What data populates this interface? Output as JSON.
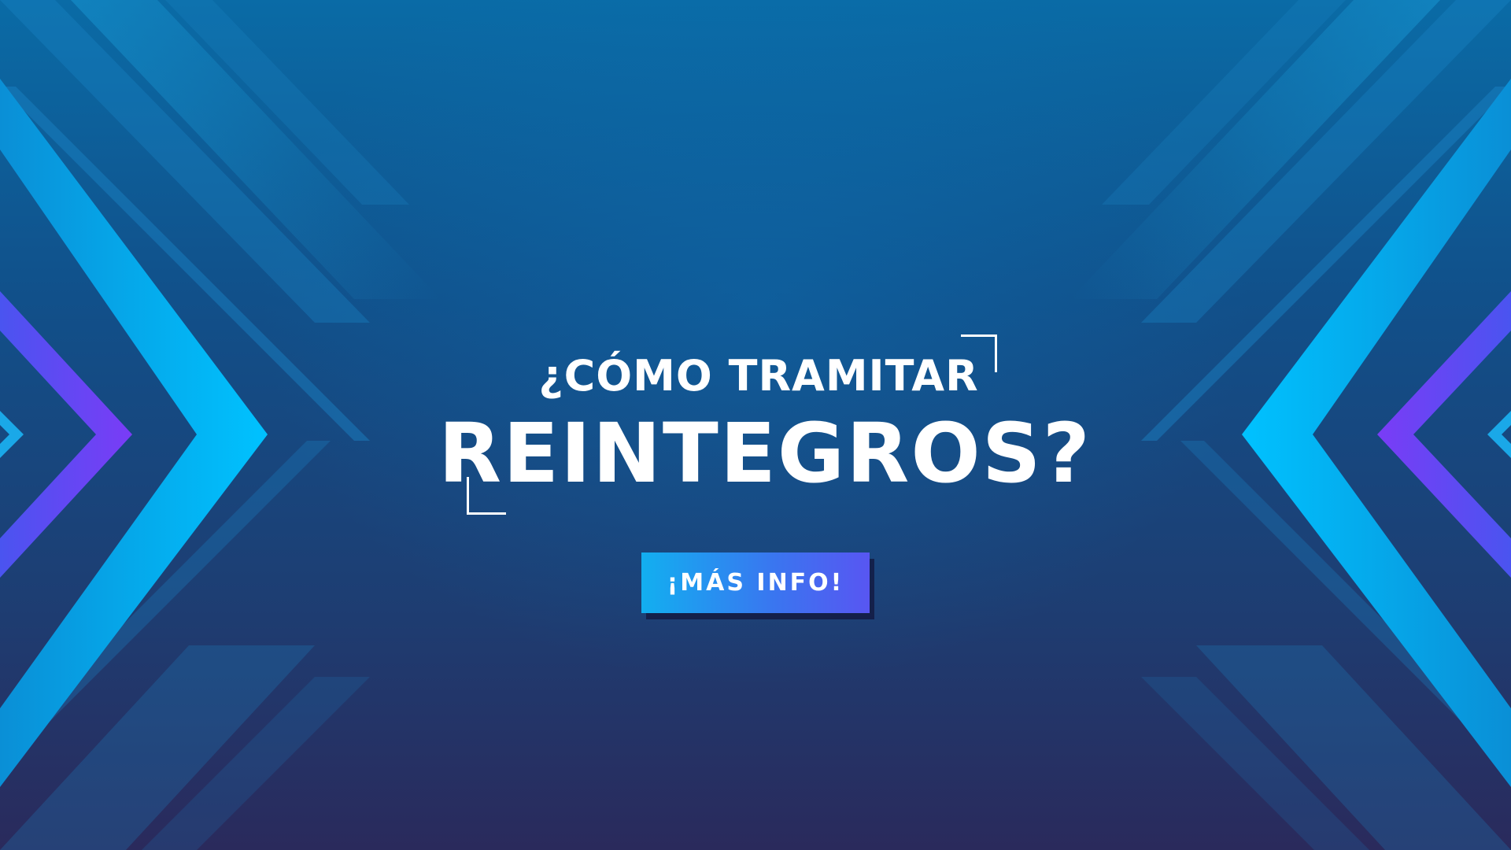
{
  "banner": {
    "heading_line1": "¿CÓMO TRAMITAR",
    "heading_line2": "REINTEGROS?",
    "cta_label": "¡MÁS INFO!"
  },
  "colors": {
    "background_top": "#0a6ba6",
    "background_bottom": "#2a2a5c",
    "accent_cyan": "#00bcf5",
    "accent_violet": "#6a3df5",
    "text": "#ffffff"
  }
}
